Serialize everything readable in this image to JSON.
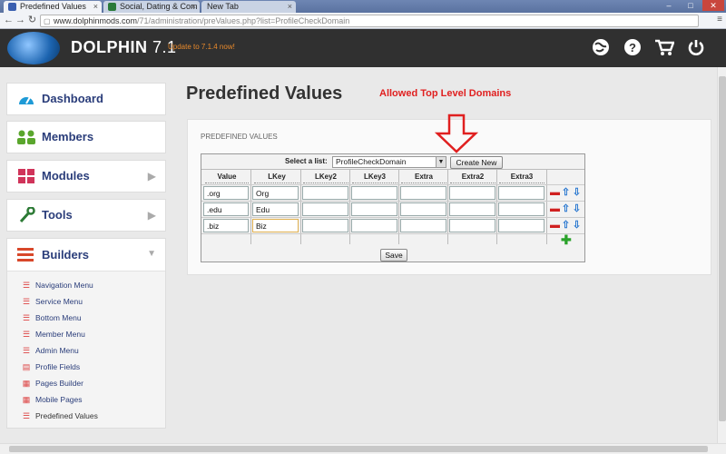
{
  "browser": {
    "tabs": [
      {
        "label": "Predefined Values",
        "active": true,
        "favicon_color": "#3a5fb0"
      },
      {
        "label": "Social, Dating & Com",
        "active": false,
        "favicon_color": "#2a7a3a"
      },
      {
        "label": "New Tab",
        "active": false,
        "favicon_color": ""
      }
    ],
    "url_host": "www.dolphinmods.com",
    "url_path": "/71/administration/preValues.php?list=ProfileCheckDomain"
  },
  "header": {
    "brand": "DOLPHIN",
    "version": "7.1",
    "update_text": "Update to 7.1.4 now!",
    "icons": [
      "globe-icon",
      "help-icon",
      "cart-icon",
      "power-icon"
    ]
  },
  "sidebar": {
    "items": [
      {
        "label": "Dashboard",
        "icon": "dashboard-icon",
        "color": "#1e9ad6",
        "has_chevron": false
      },
      {
        "label": "Members",
        "icon": "members-icon",
        "color": "#5aa62d",
        "has_chevron": false
      },
      {
        "label": "Modules",
        "icon": "modules-icon",
        "color": "#d0345a",
        "has_chevron": true
      },
      {
        "label": "Tools",
        "icon": "wrench-icon",
        "color": "#2c7a35",
        "has_chevron": true
      }
    ],
    "builders": {
      "label": "Builders",
      "items": [
        "Navigation Menu",
        "Service Menu",
        "Bottom Menu",
        "Member Menu",
        "Admin Menu",
        "Profile Fields",
        "Pages Builder",
        "Mobile Pages",
        "Predefined Values"
      ]
    }
  },
  "main": {
    "title": "Predefined Values",
    "annotation": "Allowed Top Level Domains",
    "panel_title": "PREDEFINED VALUES",
    "select_label": "Select a list:",
    "select_value": "ProfileCheckDomain",
    "create_new": "Create New",
    "columns": [
      "Value",
      "LKey",
      "LKey2",
      "LKey3",
      "Extra",
      "Extra2",
      "Extra3"
    ],
    "rows": [
      [
        ".org",
        "Org",
        "",
        "",
        "",
        "",
        ""
      ],
      [
        ".edu",
        "Edu",
        "",
        "",
        "",
        "",
        ""
      ],
      [
        ".biz",
        "Biz",
        "",
        "",
        "",
        "",
        ""
      ]
    ],
    "save": "Save"
  },
  "colors": {
    "header_bg": "#303030",
    "nav_text": "#2a3d7a",
    "update_orange": "#e98a2c",
    "annotation_red": "#e02020"
  }
}
